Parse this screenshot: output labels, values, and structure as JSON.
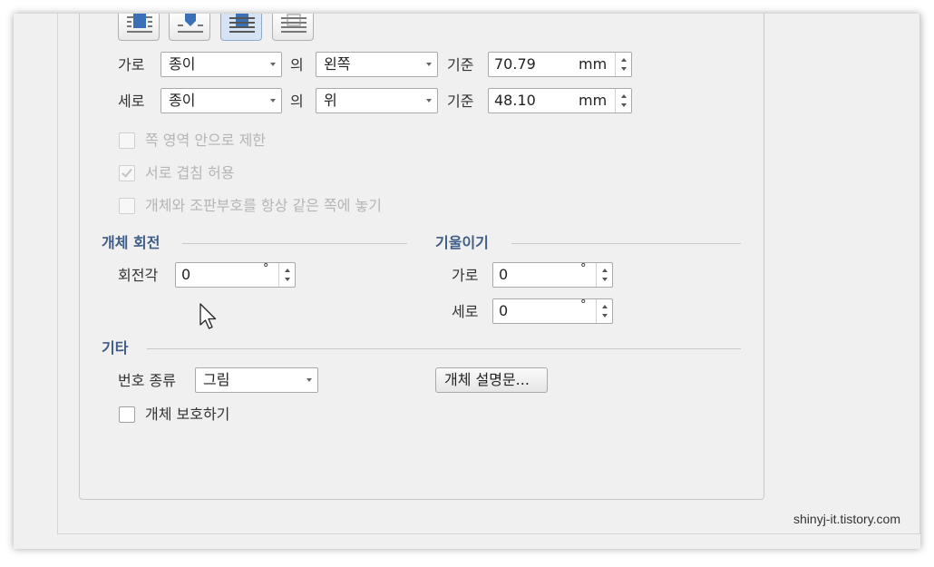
{
  "position": {
    "horizontal": {
      "label": "가로",
      "relative_to": "종이",
      "of_label": "의",
      "align": "왼쪽",
      "base_label": "기준",
      "value": "70.79",
      "unit": "mm"
    },
    "vertical": {
      "label": "세로",
      "relative_to": "종이",
      "of_label": "의",
      "align": "위",
      "base_label": "기준",
      "value": "48.10",
      "unit": "mm"
    }
  },
  "options": [
    {
      "label": "쪽 영역 안으로 제한",
      "checked": false,
      "enabled": false
    },
    {
      "label": "서로 겹침 허용",
      "checked": true,
      "enabled": false
    },
    {
      "label": "개체와 조판부호를 항상 같은 쪽에 놓기",
      "checked": false,
      "enabled": false
    }
  ],
  "rotation": {
    "title": "개체 회전",
    "angle_label": "회전각",
    "angle_value": "0",
    "unit": "°"
  },
  "skew": {
    "title": "기울이기",
    "horizontal_label": "가로",
    "horizontal_value": "0",
    "vertical_label": "세로",
    "vertical_value": "0",
    "unit": "°"
  },
  "other": {
    "title": "기타",
    "number_type_label": "번호 종류",
    "number_type_value": "그림",
    "description_button": "개체 설명문...",
    "protect_label": "개체 보호하기",
    "protect_checked": false
  },
  "toolbar_icons": [
    "wrap-square-icon",
    "wrap-tight-icon",
    "wrap-behind-text-icon",
    "wrap-in-front-text-icon"
  ],
  "watermark": "shinyj-it.tistory.com",
  "colors": {
    "section_title": "#3e5d86",
    "selected_button": "#d5e3f5",
    "disabled_text": "#b5b5b5"
  }
}
